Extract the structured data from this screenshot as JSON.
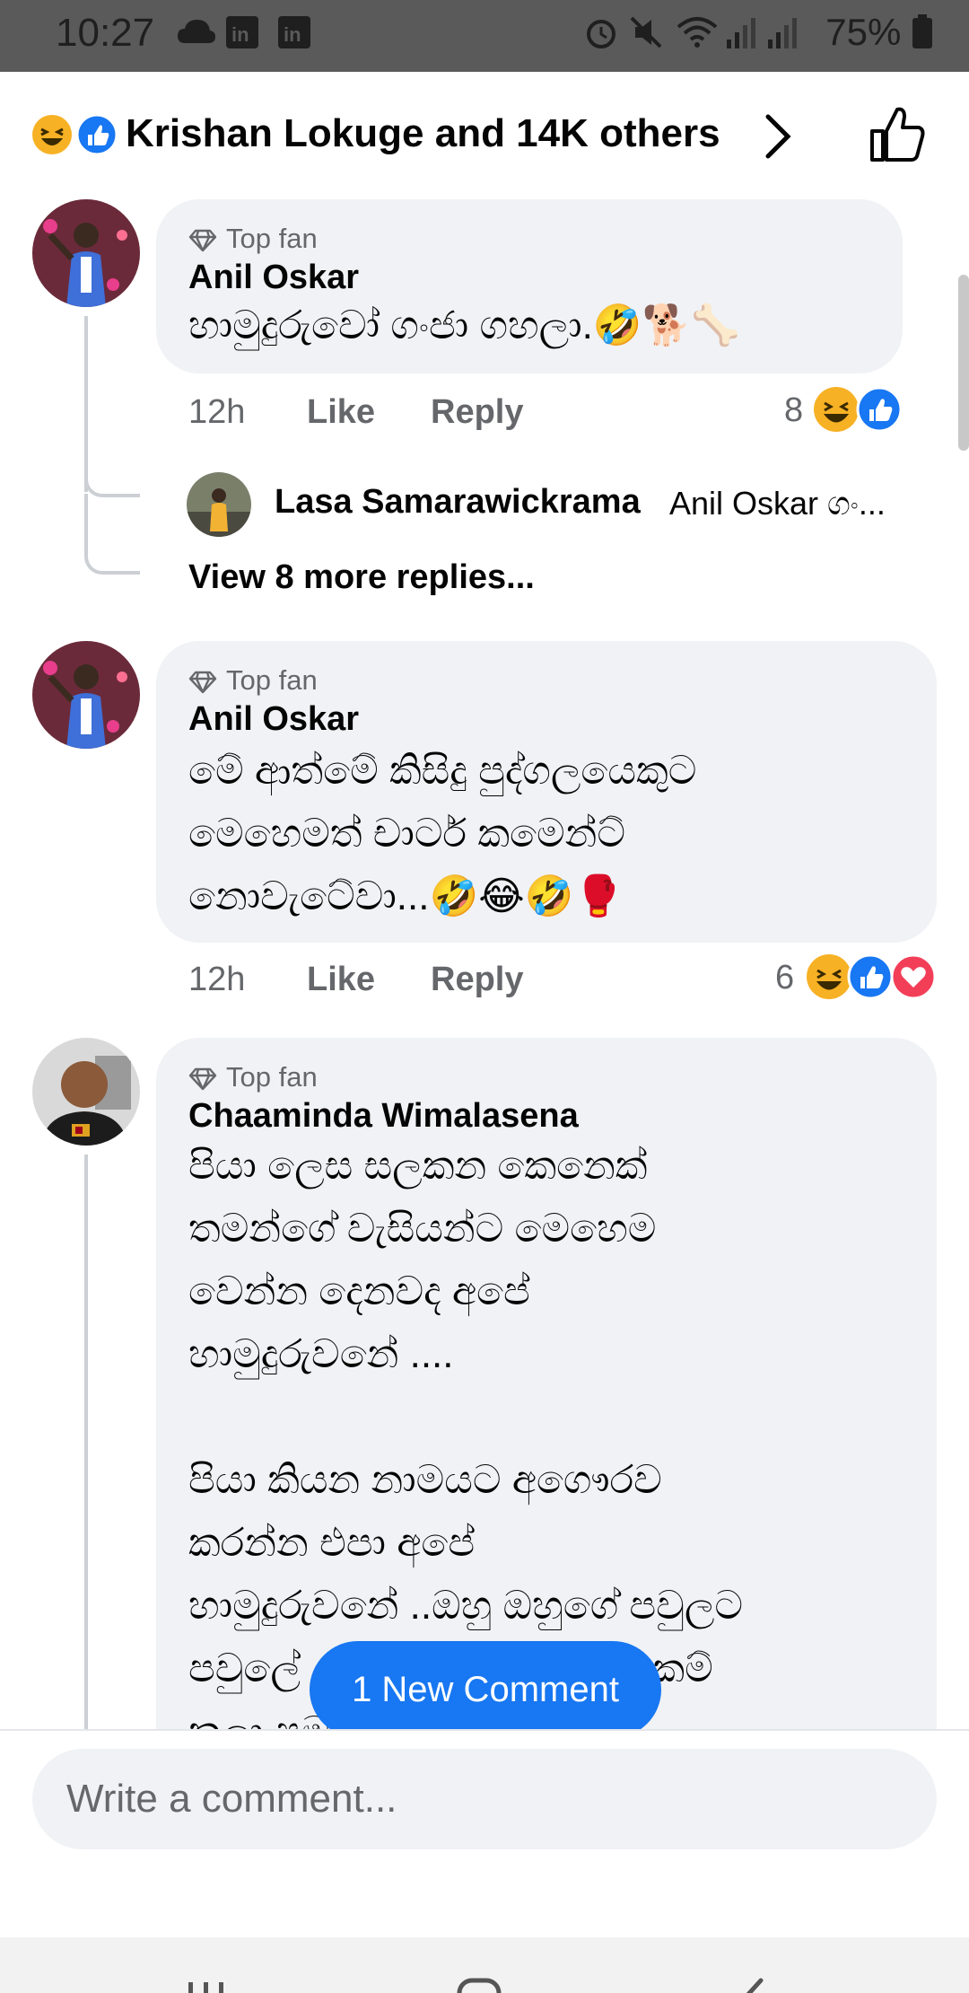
{
  "status_bar": {
    "time": "10:27",
    "battery": "75%"
  },
  "header": {
    "title": "Krishan Lokuge and 14K others"
  },
  "comments": [
    {
      "badge": "Top fan",
      "author": "Anil Oskar",
      "text": "හාමුදුරුවෝ ගංජා ගහලා.🤣🐕🦴",
      "time": "12h",
      "like": "Like",
      "reply": "Reply",
      "reaction_count": "8",
      "reply_preview": {
        "author": "Lasa Samarawickrama",
        "text": "Anil Oskar ගං..."
      },
      "more_replies": "View 8 more replies..."
    },
    {
      "badge": "Top fan",
      "author": "Anil Oskar",
      "text": "මේ ආත්මේ කිසිදු පුද්ගලයෙකුට\nමෙහෙමත් චාටර් කමෙන්ට්\nනොවැටේවා...🤣😂🤣🥊",
      "time": "12h",
      "like": "Like",
      "reply": "Reply",
      "reaction_count": "6"
    },
    {
      "badge": "Top fan",
      "author": "Chaaminda Wimalasena",
      "text": "පියා ලෙස සලකන කෙනෙක්\nතමන්ගේ වැසියන්ට මෙහෙම\nවෙන්න දෙනවද අපේ\nහාමුදුරුවනේ ....\n\nපියා කියන නාමයට අගෞරව\nකරන්න එපා අපේ\nහාමුදුරුවනේ ..ඔහු ඔහුගේ පවුලට\nපවුලේ                       ය යුතුකම්\nකලා පමණයි"
    }
  ],
  "new_comment_button": "1 New Comment",
  "composer": {
    "placeholder": "Write a comment..."
  },
  "colors": {
    "accent": "#1877f2",
    "bubble": "#f0f2f5",
    "secondary_text": "#65676b"
  },
  "icons": [
    "wifi-icon",
    "signal-icon",
    "battery-icon",
    "like-reaction-icon",
    "haha-reaction-icon",
    "love-reaction-icon",
    "thumbs-up-icon",
    "diamond-icon",
    "chevron-right-icon"
  ]
}
